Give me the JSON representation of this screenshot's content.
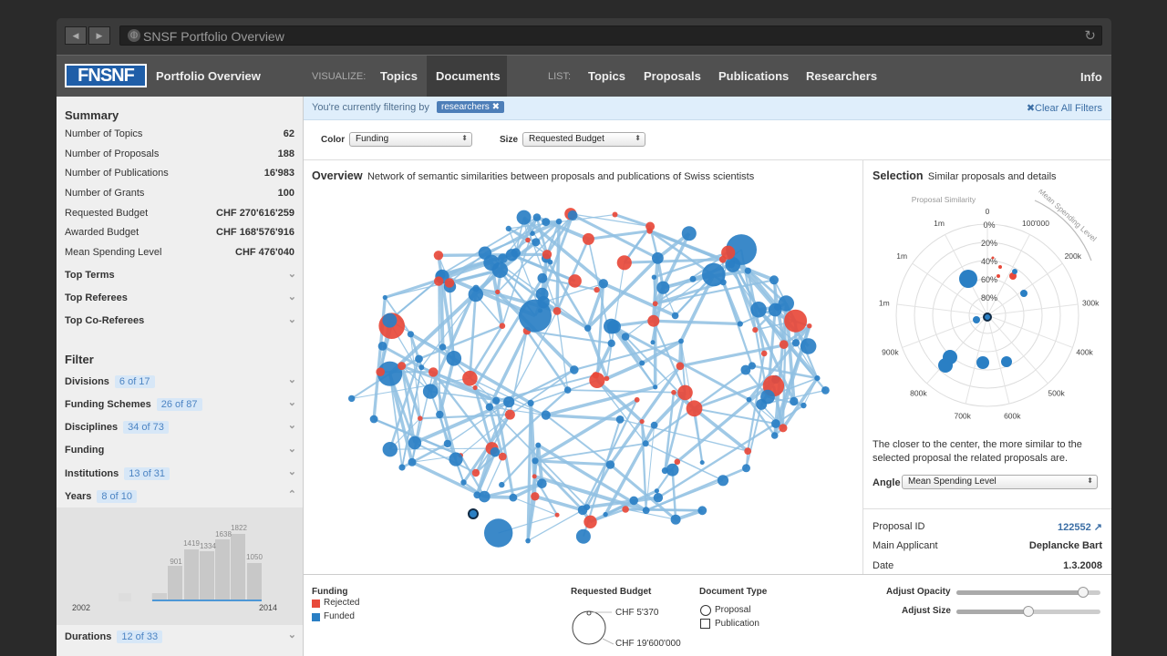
{
  "browser": {
    "title": "SNSF Portfolio Overview"
  },
  "nav": {
    "logo": "FNSNF",
    "app_title": "Portfolio Overview",
    "visualize_label": "VISUALIZE:",
    "visualize_items": [
      "Topics",
      "Documents"
    ],
    "list_label": "LIST:",
    "list_items": [
      "Topics",
      "Proposals",
      "Publications",
      "Researchers"
    ],
    "info": "Info"
  },
  "summary": {
    "heading": "Summary",
    "rows": [
      {
        "label": "Number of Topics",
        "value": "62"
      },
      {
        "label": "Number of Proposals",
        "value": "188"
      },
      {
        "label": "Number of Publications",
        "value": "16'983"
      },
      {
        "label": "Number of Grants",
        "value": "100"
      },
      {
        "label": "Requested Budget",
        "value": "CHF 270'616'259"
      },
      {
        "label": "Awarded Budget",
        "value": "CHF 168'576'916"
      },
      {
        "label": "Mean Spending Level",
        "value": "CHF 476'040"
      }
    ],
    "expanders": [
      "Top Terms",
      "Top Referees",
      "Top Co-Referees"
    ]
  },
  "filter": {
    "heading": "Filter",
    "items": [
      {
        "label": "Divisions",
        "chip": "6 of 17"
      },
      {
        "label": "Funding Schemes",
        "chip": "26 of 87"
      },
      {
        "label": "Disciplines",
        "chip": "34 of 73"
      },
      {
        "label": "Funding",
        "chip": ""
      },
      {
        "label": "Institutions",
        "chip": "13 of 31"
      },
      {
        "label": "Years",
        "chip": "8 of 10"
      }
    ],
    "durations": {
      "label": "Durations",
      "chip": "12 of 33"
    }
  },
  "years_hist": {
    "start": "2002",
    "end": "2014",
    "labels": [
      "901",
      "1419",
      "1334",
      "1638",
      "1822",
      "1050"
    ]
  },
  "filterbar": {
    "text": "You're currently filtering by",
    "tag": "researchers",
    "clear": "Clear All Filters"
  },
  "controls": {
    "color_label": "Color",
    "color_value": "Funding",
    "size_label": "Size",
    "size_value": "Requested Budget"
  },
  "overview": {
    "title": "Overview",
    "subtitle": "Network of semantic similarities between proposals and publications of Swiss scientists"
  },
  "selection": {
    "title": "Selection",
    "subtitle": "Similar proposals and details",
    "polar_title": "Proposal Similarity",
    "angle_title": "Mean Spending Level",
    "ring_labels": [
      "0%",
      "20%",
      "40%",
      "60%",
      "80%"
    ],
    "angle_labels": [
      "0",
      "100'000",
      "200k",
      "300k",
      "400k",
      "500k",
      "600k",
      "700k",
      "800k",
      "900k",
      "1m",
      "1m",
      "1m"
    ],
    "note": "The closer to the center, the more similar to the selected proposal the related proposals are.",
    "angle_label": "Angle",
    "angle_value": "Mean Spending Level",
    "details": [
      {
        "label": "Proposal ID",
        "value": "122552"
      },
      {
        "label": "Main Applicant",
        "value": "Deplancke Bart"
      },
      {
        "label": "Date",
        "value": "1.3.2008"
      }
    ]
  },
  "legend": {
    "funding_title": "Funding",
    "funding_items": [
      "Rejected",
      "Funded"
    ],
    "budget_title": "Requested Budget",
    "budget_min": "CHF 5'370",
    "budget_max": "CHF 19'600'000",
    "doctype_title": "Document Type",
    "doctype_items": [
      "Proposal",
      "Publication"
    ],
    "opacity_label": "Adjust Opacity",
    "size_label": "Adjust Size",
    "opacity_level": 0.88,
    "size_level": 0.5
  },
  "colors": {
    "rejected": "#e8493a",
    "funded": "#2a7fc4",
    "edge": "#8fbfe2"
  }
}
